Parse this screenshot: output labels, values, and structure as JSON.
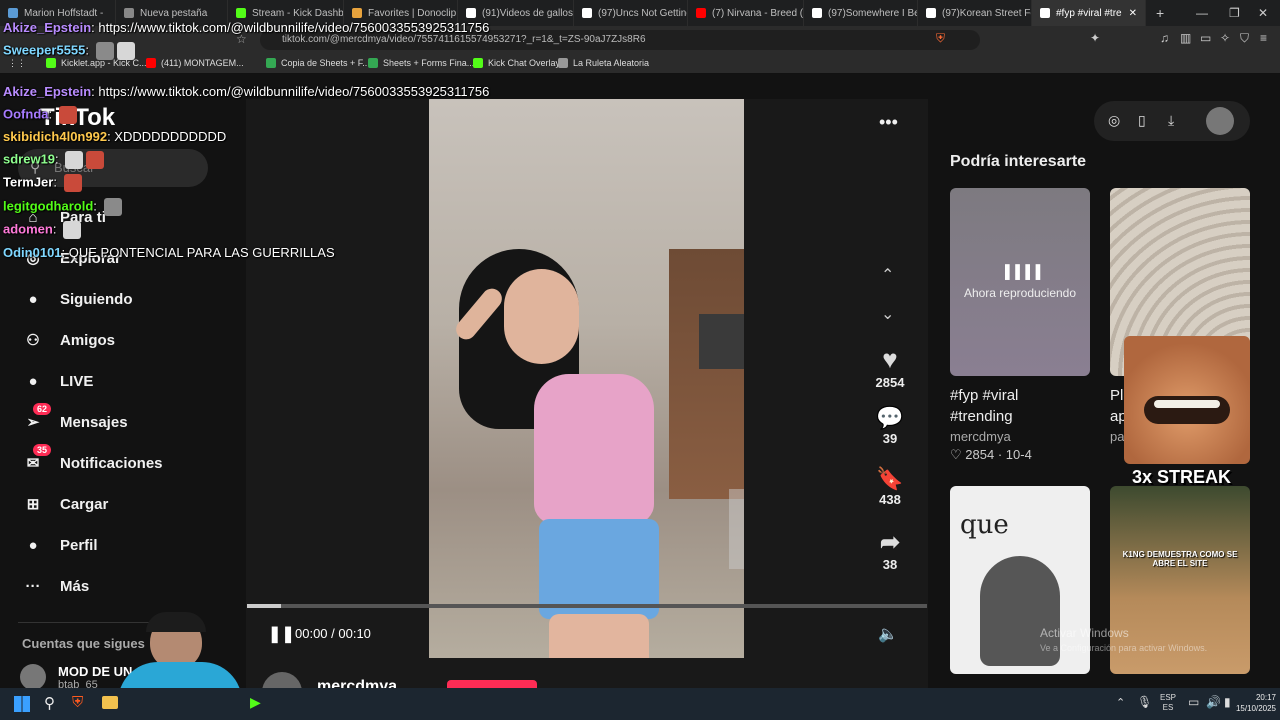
{
  "browser": {
    "tabs": [
      {
        "label": "Marion Hoffstadt -",
        "icon": "tab-icon",
        "color": "#5b9bd5"
      },
      {
        "label": "Nueva pestaña",
        "icon": "tab-icon",
        "color": "#888888"
      },
      {
        "label": "Stream - Kick Dashbo",
        "icon": "kick-icon",
        "color": "#53fc18"
      },
      {
        "label": "Favorites | Donoclip",
        "icon": "donoclip-icon",
        "color": "#e8a33d"
      },
      {
        "label": "(91)Videos de gallos C",
        "icon": "tiktok-icon",
        "color": "#ffffff"
      },
      {
        "label": "(97)Uncs Not Getting",
        "icon": "tiktok-icon",
        "color": "#ffffff"
      },
      {
        "label": "(7) Nirvana - Breed (Li",
        "icon": "youtube-icon",
        "color": "#ff0000"
      },
      {
        "label": "(97)Somewhere I Belo",
        "icon": "tiktok-icon",
        "color": "#ffffff"
      },
      {
        "label": "(97)Korean Street Foo",
        "icon": "tiktok-icon",
        "color": "#ffffff"
      },
      {
        "label": "#fyp #viral #tre",
        "icon": "tiktok-icon",
        "color": "#ffffff"
      }
    ],
    "url": "tiktok.com/@mercdmya/video/7557411615574953271?_r=1&_t=ZS-90aJ7ZJs8R6",
    "bookmarks": [
      {
        "label": "Kicklet.app - Kick C...",
        "color": "#53fc18"
      },
      {
        "label": "(411) MONTAGEM...",
        "color": "#ff0000"
      },
      {
        "label": "Copia de Sheets + F...",
        "color": "#34a853"
      },
      {
        "label": "Sheets + Forms Fina...",
        "color": "#34a853"
      },
      {
        "label": "Kick Chat Overlay",
        "color": "#53fc18"
      },
      {
        "label": "La Ruleta Aleatoria",
        "color": "#999999"
      }
    ]
  },
  "tiktok": {
    "logo": "TikTok",
    "search_placeholder": "Buscar",
    "nav": [
      {
        "label": "Para ti",
        "icon": "home-icon"
      },
      {
        "label": "Explorar",
        "icon": "compass-icon"
      },
      {
        "label": "Siguiendo",
        "icon": "following-icon"
      },
      {
        "label": "Amigos",
        "icon": "friends-icon"
      },
      {
        "label": "LIVE",
        "icon": "live-icon"
      },
      {
        "label": "Mensajes",
        "icon": "message-icon",
        "badge": "62"
      },
      {
        "label": "Notificaciones",
        "icon": "inbox-icon",
        "badge": "35"
      },
      {
        "label": "Cargar",
        "icon": "upload-icon"
      },
      {
        "label": "Perfil",
        "icon": "profile-icon"
      },
      {
        "label": "Más",
        "icon": "more-icon"
      }
    ],
    "following_heading": "Cuentas que sigues",
    "following_account": {
      "name": "MOD DE UN STR",
      "handle": "btab_65"
    },
    "video": {
      "likes": "2854",
      "comments": "39",
      "saves": "438",
      "shares": "38",
      "time": "00:00 / 00:10",
      "progress": 0.05,
      "author": "mercdmya"
    },
    "recommended": {
      "heading": "Podría interesarte",
      "now_playing": "Ahora reproduciendo",
      "card1": {
        "title": "#fyp #viral #trending",
        "author": "mercdmya",
        "likes": "2854",
        "date": "10-4"
      },
      "card2": {
        "title_partial": "Pl ap",
        "author_partial": "pa"
      },
      "card3_text": "que",
      "card4_text": "K1NG DEMUESTRA COMO SE ABRE EL SITE"
    }
  },
  "overlay": {
    "streak": "3x STREAK",
    "activate_windows": {
      "title": "Activar Windows",
      "subtitle": "Ve a Configuración para activar Windows."
    },
    "chat": [
      {
        "user": "Akize_Epstein",
        "color": "#b98cff",
        "text": "https://www.tiktok.com/@wildbunnilife/video/7560033553925311756",
        "emotes": 0
      },
      {
        "user": "Sweeper5555",
        "color": "#7fd7ff",
        "text": "",
        "emotes": 2
      },
      {
        "user": "Akize_Epstein",
        "color": "#b98cff",
        "text": "https://www.tiktok.com/@wildbunnilife/video/7560033553925311756",
        "emotes": 0
      },
      {
        "user": "Oofnda",
        "color": "#a77bff",
        "text": "",
        "emotes": 1
      },
      {
        "user": "skibidich4l0n992",
        "color": "#ffc94d",
        "text": "XDDDDDDDDDDD",
        "emotes": 0
      },
      {
        "user": "sdrew19",
        "color": "#8fff8f",
        "text": "",
        "emotes": 2
      },
      {
        "user": "TermJer",
        "color": "#ffffff",
        "text": "",
        "emotes": 1
      },
      {
        "user": "legitgodharold",
        "color": "#53fc18",
        "text": "",
        "emotes": 1
      },
      {
        "user": "adomen",
        "color": "#ff7ad9",
        "text": "",
        "emotes": 1
      },
      {
        "user": "Odin0101",
        "color": "#7fd7ff",
        "text": "QUE PONTENCIAL PARA LAS GUERRILLAS",
        "emotes": 0
      }
    ]
  },
  "taskbar": {
    "lang": "ESP",
    "lang_sub": "ES",
    "time": "20:17",
    "date": "15/10/2025"
  }
}
